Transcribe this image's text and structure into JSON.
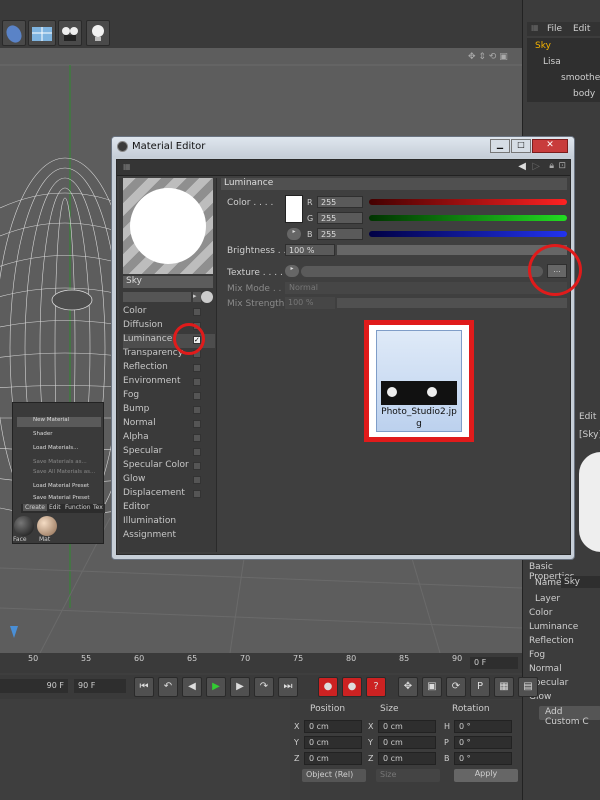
{
  "menu": {
    "file": "File",
    "edit": "Edit"
  },
  "object_tree": {
    "items": [
      "Sky",
      "Lisa",
      "smoothed",
      "body"
    ]
  },
  "material_editor": {
    "title": "Material Editor",
    "material_name": "Sky",
    "channels": [
      "Color",
      "Diffusion",
      "Luminance",
      "Transparency",
      "Reflection",
      "Environment",
      "Fog",
      "Bump",
      "Normal",
      "Alpha",
      "Specular",
      "Specular Color",
      "Glow",
      "Displacement",
      "Editor",
      "Illumination",
      "Assignment"
    ],
    "luminance": {
      "heading": "Luminance",
      "color_label": "Color . . . .",
      "r_label": "R",
      "g_label": "G",
      "b_label": "B",
      "r": "255",
      "g": "255",
      "b": "255",
      "brightness_label": "Brightness . .",
      "brightness": "100 %",
      "texture_label": "Texture . . . .",
      "browse": "...",
      "mix_mode_label": "Mix Mode . .",
      "mix_mode": "Normal",
      "mix_strength_label": "Mix Strength",
      "mix_strength": "100 %"
    },
    "texture_file": {
      "name_line1": "Photo_Studio2.jp",
      "name_line2": "g"
    }
  },
  "context_menu": {
    "items": [
      "New Material",
      "Shader",
      "Load Materials...",
      "Save Materials as...",
      "Save All Materials as...",
      "Load Material Preset",
      "Save Material Preset"
    ],
    "tabs": [
      "Create",
      "Edit",
      "Function",
      "Tex"
    ],
    "swatches": [
      "Face",
      "Mat"
    ]
  },
  "timeline": {
    "ticks": [
      "50",
      "55",
      "60",
      "65",
      "70",
      "75",
      "80",
      "85",
      "90"
    ],
    "current": "0 F",
    "end_a": "90 F",
    "end_b": "90 F"
  },
  "coordinates": {
    "headers": [
      "Position",
      "Size",
      "Rotation"
    ],
    "rows": [
      [
        "X",
        "0 cm",
        "X",
        "0 cm",
        "H",
        "0 °"
      ],
      [
        "Y",
        "0 cm",
        "Y",
        "0 cm",
        "P",
        "0 °"
      ],
      [
        "Z",
        "0 cm",
        "Z",
        "0 cm",
        "B",
        "0 °"
      ]
    ],
    "mode": "Object (Rel)",
    "size_mode": "Size",
    "apply": "Apply"
  },
  "attributes": {
    "edit": "Edit",
    "tag": "[Sky]",
    "section": "Basic Properties",
    "name_label": "Name",
    "name_value": "Sky",
    "layer_label": "Layer",
    "props": [
      "Color",
      "Luminance",
      "Reflection",
      "Fog",
      "Normal",
      "Specular",
      "Glow"
    ],
    "add_custom": "Add Custom C"
  }
}
